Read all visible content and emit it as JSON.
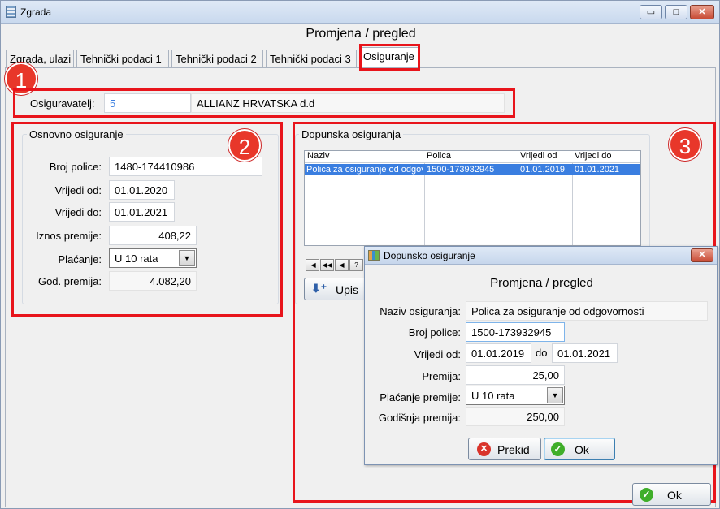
{
  "window": {
    "title": "Zgrada",
    "heading": "Promjena / pregled",
    "controls": {
      "minimize": "▭",
      "maximize": "□",
      "close": "✕"
    }
  },
  "tabs": [
    "Zgrada, ulazi",
    "Tehnički podaci 1",
    "Tehnički podaci 2",
    "Tehnički podaci 3",
    "Osiguranje"
  ],
  "active_tab": "Osiguranje",
  "insurer": {
    "label": "Osiguravatelj:",
    "code": "5",
    "name": "ALLIANZ HRVATSKA d.d"
  },
  "basic": {
    "title": "Osnovno osiguranje",
    "policy_label": "Broj police:",
    "policy": "1480-174410986",
    "valid_from_label": "Vrijedi od:",
    "valid_from": "01.01.2020",
    "valid_to_label": "Vrijedi do:",
    "valid_to": "01.01.2021",
    "premium_label": "Iznos premije:",
    "premium": "408,22",
    "payment_label": "Plaćanje:",
    "payment": "U 10 rata",
    "annual_label": "God. premija:",
    "annual": "4.082,20"
  },
  "supplementary": {
    "title": "Dopunska osiguranja",
    "columns": [
      "Naziv",
      "Polica",
      "Vrijedi od",
      "Vrijedi do"
    ],
    "rows": [
      [
        "Polica za osiguranje od odgovornosti",
        "1500-173932945",
        "01.01.2019",
        "01.01.2021"
      ]
    ],
    "nav": [
      "|◀",
      "◀◀",
      "◀",
      "?"
    ],
    "add_button": "Upis"
  },
  "dialog": {
    "title": "Dopunsko osiguranje",
    "heading": "Promjena / pregled",
    "name_label": "Naziv osiguranja:",
    "name": "Polica za osiguranje od odgovornosti",
    "policy_label": "Broj police:",
    "policy": "1500-173932945",
    "valid_from_label": "Vrijedi od:",
    "valid_from": "01.01.2019",
    "to_label": "do",
    "valid_to": "01.01.2021",
    "premium_label": "Premija:",
    "premium": "25,00",
    "payment_label": "Plaćanje premije:",
    "payment": "U 10 rata",
    "annual_label": "Godišnja premija:",
    "annual": "250,00",
    "cancel_button": "Prekid",
    "ok_button": "Ok",
    "close": "✕"
  },
  "main_ok_button": "Ok",
  "annotations": [
    "1",
    "2",
    "3"
  ],
  "colors": {
    "highlight": "#e8141b",
    "selection": "#3a7ee0"
  }
}
